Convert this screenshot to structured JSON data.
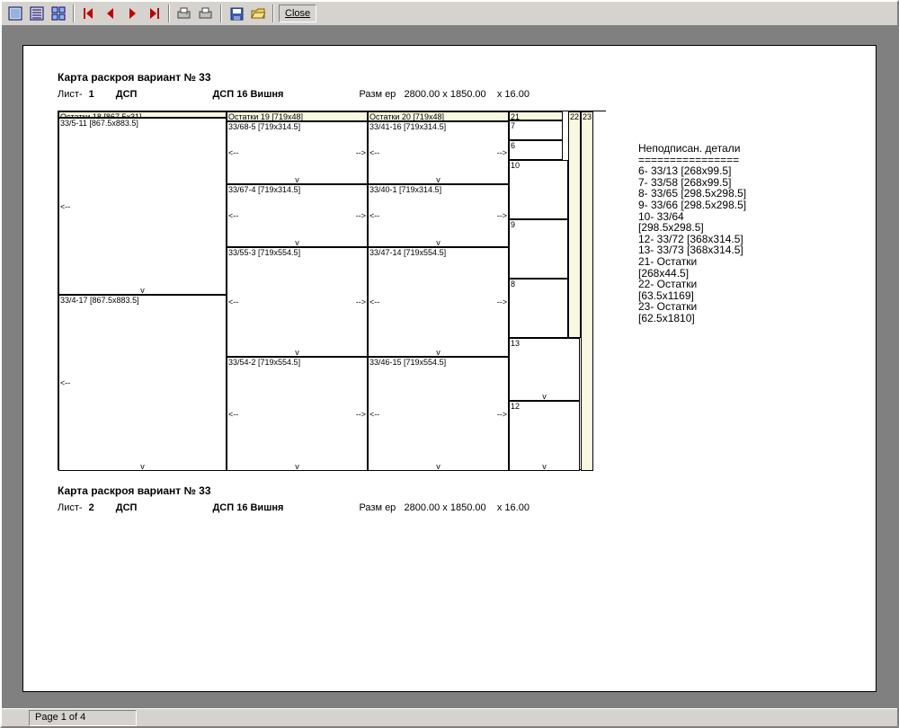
{
  "toolbar": {
    "close": "Close"
  },
  "report": {
    "title": "Карта раскроя вариант № 33",
    "sheet1": {
      "sheet_label": "Лист-",
      "sheet_no": "1",
      "material_code": "ДСП",
      "material_name": "ДСП 16 Вишня",
      "size_label": "Разм ер",
      "size_value": "2800.00 x  1850.00",
      "thickness": "x  16.00"
    },
    "sheet2": {
      "sheet_label": "Лист-",
      "sheet_no": "2",
      "material_code": "ДСП",
      "material_name": "ДСП 16 Вишня",
      "size_label": "Разм ер",
      "size_value": "2800.00 x  1850.00",
      "thickness": "x  16.00"
    },
    "pieces": {
      "ost18": "Остатки 18 [867.5x31]",
      "p33_5_11": "33/5-11 [867.5x883.5]",
      "p33_4_17": "33/4-17 [867.5x883.5]",
      "ost19": "Остатки 19 [719x48]",
      "p33_68_5": "33/68-5 [719x314.5]",
      "p33_67_4": "33/67-4 [719x314.5]",
      "p33_55_3": "33/55-3 [719x554.5]",
      "p33_54_2": "33/54-2 [719x554.5]",
      "ost20": "Остатки 20 [719x48]",
      "p33_41_16": "33/41-16 [719x314.5]",
      "p33_40_1": "33/40-1 [719x314.5]",
      "p33_47_14": "33/47-14 [719x554.5]",
      "p33_46_15": "33/46-15 [719x554.5]",
      "n21": "21",
      "n22": "22",
      "n23": "23",
      "n7": "7",
      "n6": "6",
      "n10": "10",
      "n9": "9",
      "n8": "8",
      "n13": "13",
      "n12": "12"
    },
    "arrows": {
      "left": "<--",
      "right": "-->",
      "down": "v"
    },
    "unsigned": {
      "title": "Неподписан. детали",
      "sep": "================",
      "lines": [
        "6- 33/13 [268x99.5]",
        "7- 33/58 [268x99.5]",
        "8- 33/65 [298.5x298.5]",
        "9- 33/66 [298.5x298.5]",
        "10- 33/64",
        "[298.5x298.5]",
        "12- 33/72 [368x314.5]",
        "13- 33/73 [368x314.5]",
        "21- Остатки",
        "[268x44.5]",
        "22- Остатки",
        "[63.5x1169]",
        "23- Остатки",
        "[62.5x1810]"
      ]
    }
  },
  "status": {
    "page_text": "Page 1 of 4"
  }
}
